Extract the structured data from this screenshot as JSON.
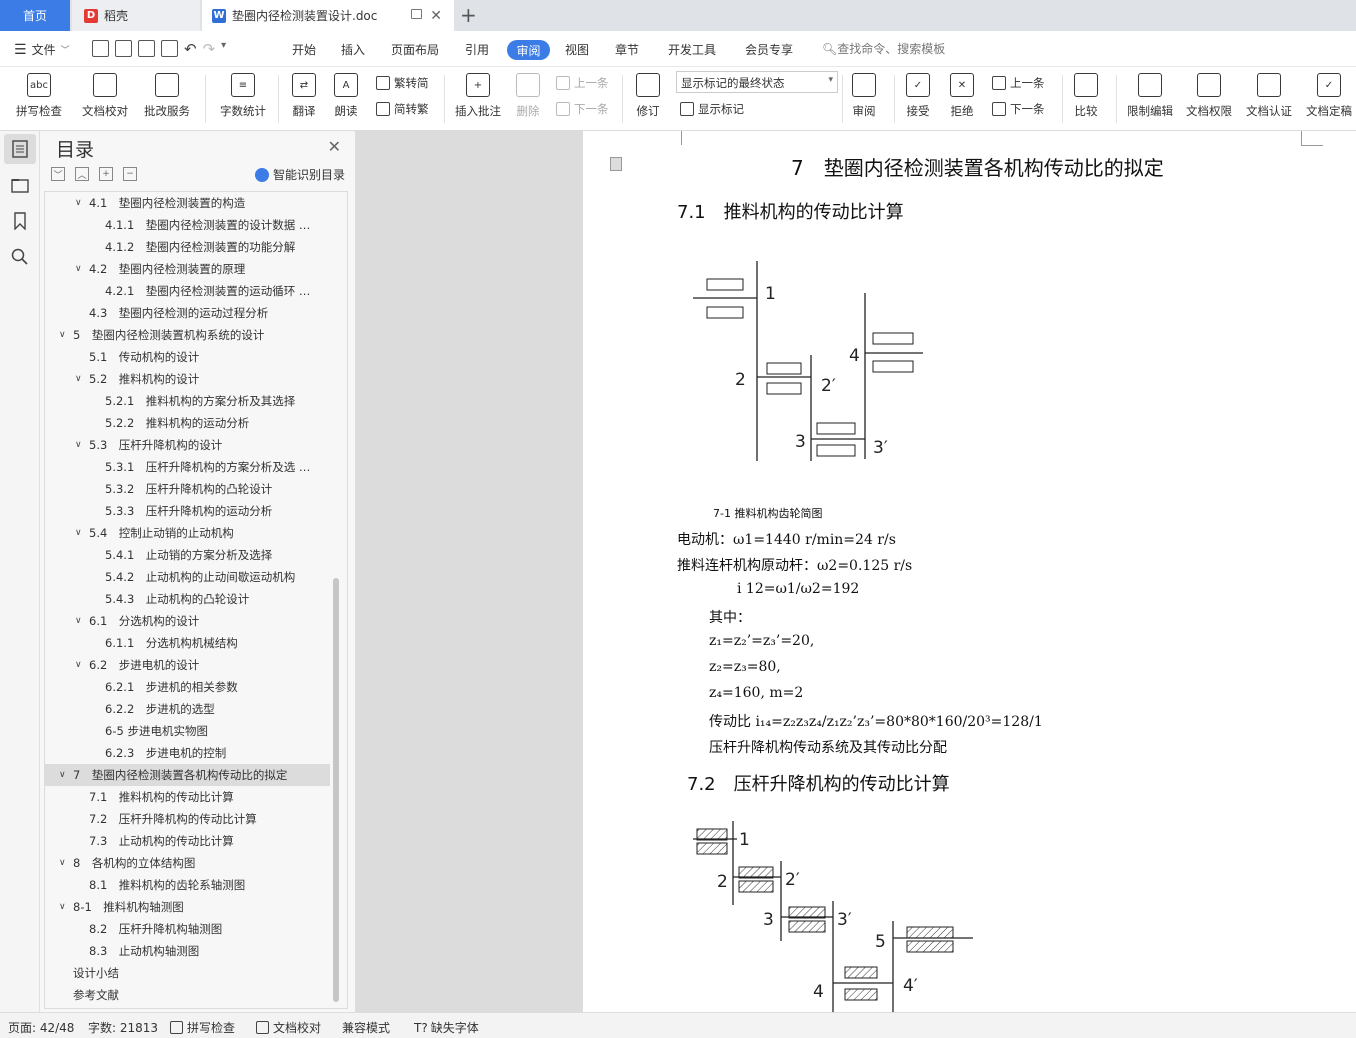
{
  "tabs": {
    "home": "首页",
    "daoke": "稻壳",
    "document": "垫圈内径检测装置设计.doc"
  },
  "menu": {
    "file": "文件",
    "items": [
      "开始",
      "插入",
      "页面布局",
      "引用"
    ],
    "active": "审阅",
    "items2": [
      "视图",
      "章节",
      "开发工具",
      "会员专享"
    ],
    "search": "查找命令、搜索模板"
  },
  "ribbon": {
    "spell": "拼写检查",
    "proof": "文档校对",
    "correction": "批改服务",
    "wordcount": "字数统计",
    "translate": "翻译",
    "read": "朗读",
    "trad2simp": "繁转简",
    "simp2trad": "简转繁",
    "insert_comment": "插入批注",
    "delete": "删除",
    "prev": "上一条",
    "next": "下一条",
    "revise": "修订",
    "markup_state": "显示标记的最终状态",
    "show_markup": "显示标记",
    "review": "审阅",
    "accept": "接受",
    "reject": "拒绝",
    "prev2": "上一条",
    "next2": "下一条",
    "compare": "比较",
    "restrict": "限制编辑",
    "permission": "文档权限",
    "certify": "文档认证",
    "finalize": "文档定稿"
  },
  "toc": {
    "title": "目录",
    "smart": "智能识别目录",
    "items": [
      {
        "label": "4.1　垫圈内径检测装置的构造",
        "level": 1,
        "arrow": "v"
      },
      {
        "label": "4.1.1　垫圈内径检测装置的设计数据 …",
        "level": 2
      },
      {
        "label": "4.1.2　垫圈内径检测装置的功能分解",
        "level": 2
      },
      {
        "label": "4.2　垫圈内径检测装置的原理",
        "level": 1,
        "arrow": "v"
      },
      {
        "label": "4.2.1　垫圈内径检测装置的运动循环 …",
        "level": 2
      },
      {
        "label": "4.3　垫圈内径检测的运动过程分析",
        "level": 1
      },
      {
        "label": "5　垫圈内径检测装置机构系统的设计",
        "level": 0,
        "arrow": "v"
      },
      {
        "label": "5.1　传动机构的设计",
        "level": 1
      },
      {
        "label": "5.2　推料机构的设计",
        "level": 1,
        "arrow": "v"
      },
      {
        "label": "5.2.1　推料机构的方案分析及其选择",
        "level": 2
      },
      {
        "label": "5.2.2　推料机构的运动分析",
        "level": 2
      },
      {
        "label": "5.3　压杆升降机构的设计",
        "level": 1,
        "arrow": "v"
      },
      {
        "label": "5.3.1　压杆升降机构的方案分析及选 …",
        "level": 2
      },
      {
        "label": "5.3.2　压杆升降机构的凸轮设计",
        "level": 2
      },
      {
        "label": "5.3.3　压杆升降机构的运动分析",
        "level": 2
      },
      {
        "label": "5.4　控制止动销的止动机构",
        "level": 1,
        "arrow": "v"
      },
      {
        "label": "5.4.1　止动销的方案分析及选择",
        "level": 2
      },
      {
        "label": "5.4.2　止动机构的止动间歇运动机构",
        "level": 2
      },
      {
        "label": "5.4.3　止动机构的凸轮设计",
        "level": 2
      },
      {
        "label": "6.1　分选机构的设计",
        "level": 1,
        "arrow": "v"
      },
      {
        "label": "6.1.1　分选机构机械结构",
        "level": 2
      },
      {
        "label": "6.2　步进电机的设计",
        "level": 1,
        "arrow": "v"
      },
      {
        "label": "6.2.1　步进机的相关参数",
        "level": 2
      },
      {
        "label": "6.2.2　步进机的选型",
        "level": 2
      },
      {
        "label": "6-5 步进电机实物图",
        "level": 2
      },
      {
        "label": "6.2.3　步进电机的控制",
        "level": 2
      },
      {
        "label": "7　垫圈内径检测装置各机构传动比的拟定",
        "level": 0,
        "arrow": "v",
        "active": true
      },
      {
        "label": "7.1　推料机构的传动比计算",
        "level": 1
      },
      {
        "label": "7.2　压杆升降机构的传动比计算",
        "level": 1
      },
      {
        "label": "7.3　止动机构的传动比计算",
        "level": 1
      },
      {
        "label": "8　各机构的立体结构图",
        "level": 0,
        "arrow": "v"
      },
      {
        "label": "8.1　推料机构的齿轮系轴测图",
        "level": 1
      },
      {
        "label": "8-1　推料机构轴测图",
        "level": 0,
        "arrow": "v"
      },
      {
        "label": "8.2　压杆升降机构轴测图",
        "level": 1
      },
      {
        "label": "8.3　止动机构轴测图",
        "level": 1
      },
      {
        "label": "设计小结",
        "level": 0
      },
      {
        "label": "参考文献",
        "level": 0
      }
    ]
  },
  "doc": {
    "h1": "7　垫圈内径检测装置各机构传动比的拟定",
    "h71": "7.1　推料机构的传动比计算",
    "caption": "7-1 推料机构齿轮简图",
    "lines": [
      {
        "text": "电动机：ω1=1440 r/min=24 r/s",
        "indent": 0
      },
      {
        "text": "推料连杆机构原动杆：ω2=0.125 r/s",
        "indent": 0
      },
      {
        "text": "i 12=ω1/ω2=192",
        "indent": 60
      },
      {
        "text": "其中：",
        "indent": 32
      },
      {
        "text": "z₁=z₂’=z₃’=20,",
        "indent": 32
      },
      {
        "text": "z₂=z₃=80,",
        "indent": 32
      },
      {
        "text": "z₄=160, m=2",
        "indent": 32
      },
      {
        "text": "传动比 i₁₄=z₂z₃z₄/z₁z₂’z₃’=80*80*160/20³=128/1",
        "indent": 32
      },
      {
        "text": "压杆升降机构传动系统及其传动比分配",
        "indent": 32
      }
    ],
    "h72": "7.2　压杆升降机构的传动比计算"
  },
  "status": {
    "page": "页面: 42/48",
    "words": "字数: 21813",
    "spell": "拼写检查",
    "proof": "文档校对",
    "compat": "兼容模式",
    "font": "缺失字体"
  }
}
